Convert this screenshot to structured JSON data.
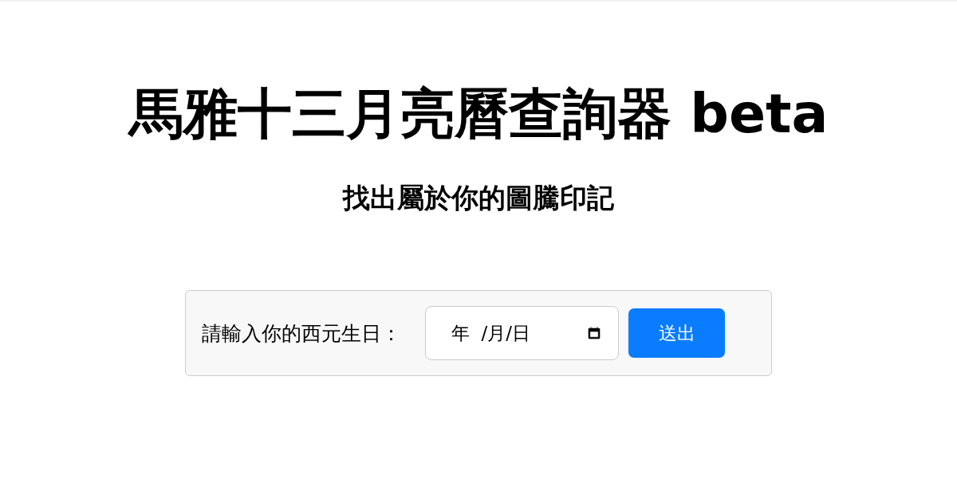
{
  "title": "馬雅十三月亮曆查詢器 beta",
  "subtitle": "找出屬於你的圖騰印記",
  "form": {
    "label": "請輸入你的西元生日：",
    "date_field": {
      "placeholder": "年  /月/日"
    },
    "submit_button": "送出"
  }
}
